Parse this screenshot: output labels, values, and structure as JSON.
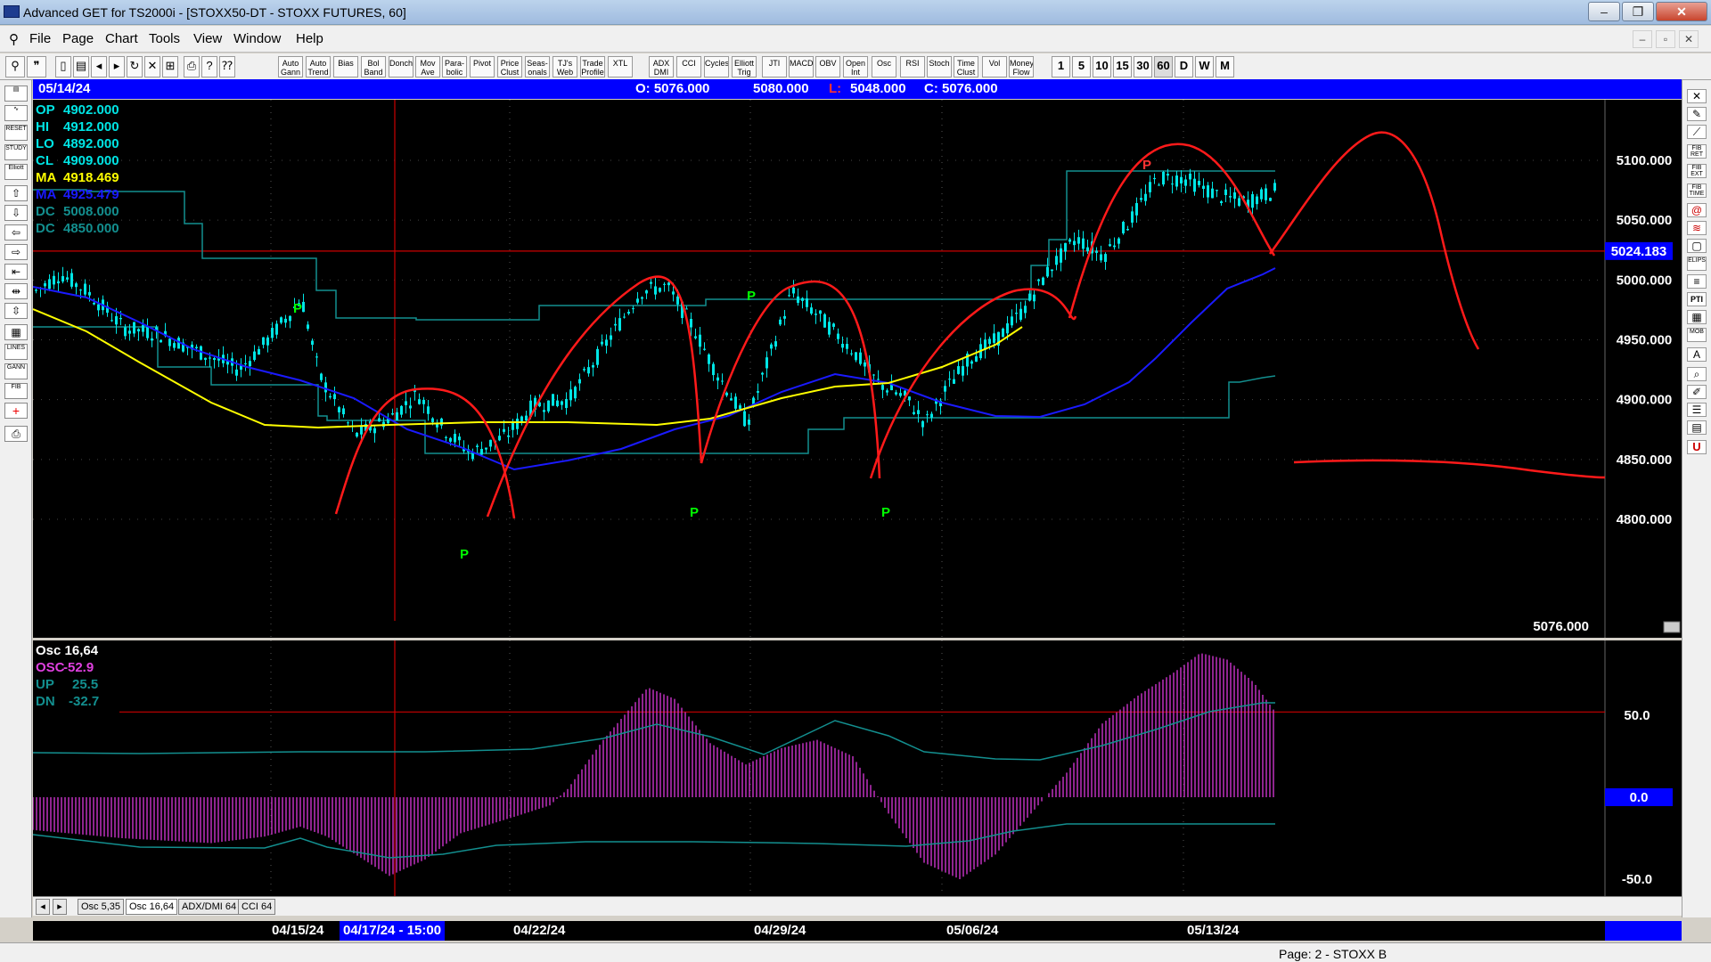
{
  "window": {
    "title": "Advanced GET for TS2000i - [STOXX50-DT - STOXX FUTURES, 60]"
  },
  "menu": [
    "File",
    "Page",
    "Chart",
    "Tools",
    "View",
    "Window",
    "Help"
  ],
  "toolbar": {
    "studies": [
      "Auto Gann",
      "Auto Trend",
      "Bias",
      "Bol Band",
      "Donch",
      "Mov Ave",
      "Para-bolic",
      "Pivot",
      "Price Clust",
      "Seas-onals",
      "TJ's Web",
      "Trade Profile",
      "XTL",
      "ADX DMI",
      "CCI",
      "Cycles",
      "Elliott Trig",
      "JTI",
      "MACD",
      "OBV",
      "Open Int",
      "Osc",
      "RSI",
      "Stoch",
      "Time Clust",
      "Vol",
      "Money Flow"
    ],
    "intervals": [
      "1",
      "5",
      "10",
      "15",
      "30",
      "60",
      "D",
      "W",
      "M"
    ]
  },
  "left_tools": [
    "RESET",
    "STUDY",
    "Elliott",
    "LINES",
    "GANN",
    "FIB"
  ],
  "right_tools": [
    "FIB RET",
    "FIB EXT",
    "FIB TIME",
    "ELIPS",
    "PTI",
    "MOB"
  ],
  "header": {
    "date": "05/14/24",
    "open": "O: 5076.000",
    "high": "5080.000",
    "low_label": "L:",
    "low": "5048.000",
    "close": "C: 5076.000"
  },
  "legend": [
    {
      "label": "OP",
      "value": "4902.000",
      "color": "#00e5e5"
    },
    {
      "label": "HI",
      "value": "4912.000",
      "color": "#00e5e5"
    },
    {
      "label": "LO",
      "value": "4892.000",
      "color": "#00e5e5"
    },
    {
      "label": "CL",
      "value": "4909.000",
      "color": "#00e5e5"
    },
    {
      "label": "MA",
      "value": "4918.469",
      "color": "#ffff00"
    },
    {
      "label": "MA",
      "value": "4925.479",
      "color": "#1a1aff"
    },
    {
      "label": "DC",
      "value": "5008.000",
      "color": "#138f8f"
    },
    {
      "label": "DC",
      "value": "4850.000",
      "color": "#138f8f"
    }
  ],
  "price_axis": {
    "ticks": [
      "5100.000",
      "5050.000",
      "5000.000",
      "4950.000",
      "4900.000",
      "4850.000",
      "4800.000"
    ],
    "marker": "5024.183",
    "last": "5076.000"
  },
  "osc": {
    "title": "Osc 16,64",
    "osc_label": "OSC",
    "osc_value": "-52.9",
    "up_label": "UP",
    "up_value": "25.5",
    "dn_label": "DN",
    "dn_value": "-32.7",
    "ticks": [
      "50.0",
      "0.0",
      "-50.0"
    ]
  },
  "tabs": [
    "Osc 5,35",
    "Osc 16,64",
    "ADX/DMI 64",
    "CCI 64"
  ],
  "dates": [
    "04/15/24",
    "04/17/24 - 15:00",
    "04/22/24",
    "04/29/24",
    "05/06/24",
    "05/13/24"
  ],
  "markers": {
    "pivot": "P"
  },
  "status": {
    "page": "Page: 2 - STOXX B"
  },
  "colors": {
    "candles": "#00e5e5",
    "ma_fast": "#ffff00",
    "ma_slow": "#1a1aff",
    "donchian": "#138f8f",
    "projection": "#ff1a1a",
    "osc": "#cc33cc",
    "pivot_low": "#00ff00",
    "pivot_high": "#ff3333"
  }
}
